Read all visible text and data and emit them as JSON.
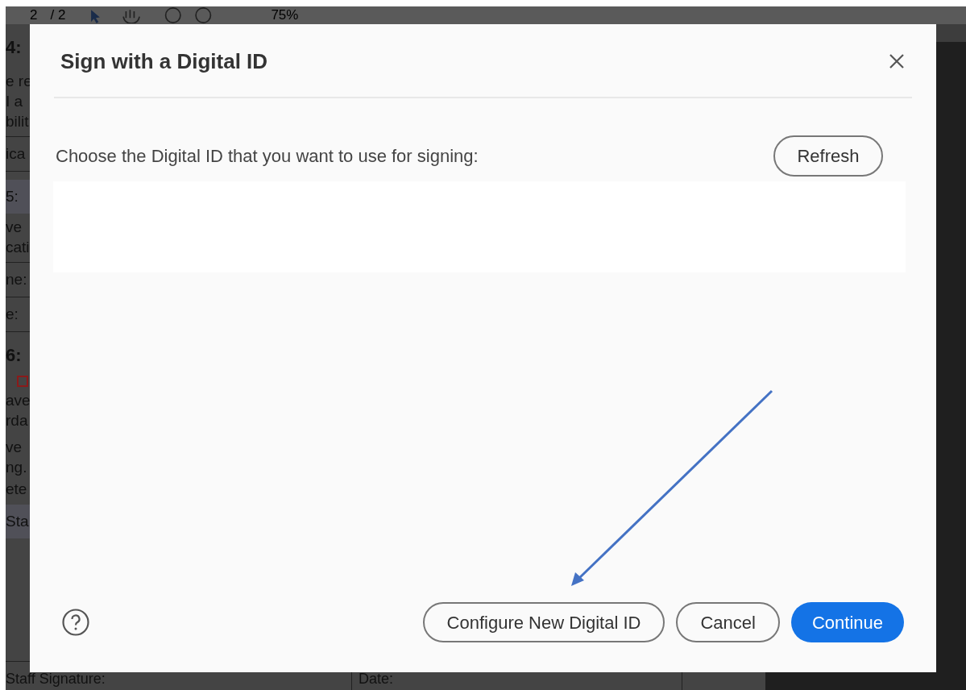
{
  "toolbar": {
    "page": "2",
    "page_count": "/ 2",
    "zoom": "75%"
  },
  "document": {
    "lines": [
      {
        "kind": "heading",
        "text": "4:"
      },
      {
        "kind": "gap"
      },
      {
        "kind": "text",
        "text": "e re"
      },
      {
        "kind": "text",
        "text": " I a"
      },
      {
        "kind": "text",
        "text": "bilit"
      },
      {
        "kind": "rule"
      },
      {
        "kind": "cell",
        "text": "ica"
      },
      {
        "kind": "rule"
      },
      {
        "kind": "band",
        "text": "5:"
      },
      {
        "kind": "text",
        "text": "ve"
      },
      {
        "kind": "text",
        "text": "cati"
      },
      {
        "kind": "rule"
      },
      {
        "kind": "cell",
        "text": "ne:"
      },
      {
        "kind": "rule"
      },
      {
        "kind": "cell",
        "text": "e:"
      },
      {
        "kind": "rule"
      },
      {
        "kind": "heading",
        "text": "6:"
      },
      {
        "kind": "checkbox",
        "checked": false
      },
      {
        "kind": "text",
        "text": "ave"
      },
      {
        "kind": "text",
        "text": "rda"
      },
      {
        "kind": "gap"
      },
      {
        "kind": "text",
        "text": "ve"
      },
      {
        "kind": "text",
        "text": "ng."
      },
      {
        "kind": "cell",
        "text": "ete"
      },
      {
        "kind": "band",
        "text": "Sta"
      }
    ],
    "footer_cells": [
      "Staff Signature:",
      "Date:"
    ]
  },
  "dialog": {
    "title": "Sign with a Digital ID",
    "prompt": "Choose the Digital ID that you want to use for signing:",
    "refresh": "Refresh",
    "buttons": [
      {
        "kind": "secondary",
        "label": "Configure New Digital ID"
      },
      {
        "kind": "secondary",
        "label": "Cancel"
      },
      {
        "kind": "primary",
        "label": "Continue"
      }
    ]
  }
}
